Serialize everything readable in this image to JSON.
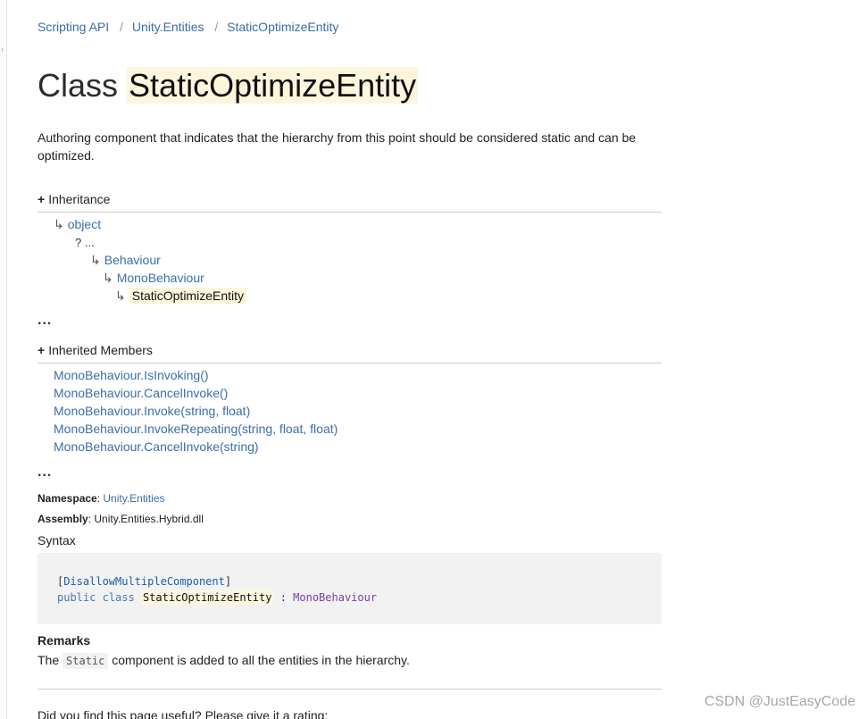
{
  "breadcrumb": {
    "items": [
      "Scripting API",
      "Unity.Entities",
      "StaticOptimizeEntity"
    ],
    "separator": "/"
  },
  "title": {
    "prefix": "Class",
    "name": "StaticOptimizeEntity"
  },
  "summary": "Authoring component that indicates that the hierarchy from this point should be considered static and can be optimized.",
  "inheritance": {
    "toggle": "+",
    "heading": "Inheritance",
    "arrow": "↳",
    "chain": {
      "object": "object",
      "gap": "? ...",
      "behaviour": "Behaviour",
      "monobehaviour": "MonoBehaviour",
      "current": "StaticOptimizeEntity"
    },
    "more": "..."
  },
  "inherited_members": {
    "toggle": "+",
    "heading": "Inherited Members",
    "items": [
      "MonoBehaviour.IsInvoking()",
      "MonoBehaviour.CancelInvoke()",
      "MonoBehaviour.Invoke(string, float)",
      "MonoBehaviour.InvokeRepeating(string, float, float)",
      "MonoBehaviour.CancelInvoke(string)"
    ],
    "more": "..."
  },
  "namespace": {
    "label": "Namespace",
    "value": "Unity.Entities"
  },
  "assembly": {
    "label": "Assembly",
    "value": "Unity.Entities.Hybrid.dll"
  },
  "syntax": {
    "label": "Syntax",
    "attr_open": "[",
    "attribute": "DisallowMultipleComponent",
    "attr_close": "]",
    "kw_public": "public",
    "kw_class": "class",
    "class_name": "StaticOptimizeEntity",
    "colon": ":",
    "base": "MonoBehaviour"
  },
  "remarks": {
    "title": "Remarks",
    "before": "The",
    "code": "Static",
    "after": "component is added to all the entities in the hierarchy."
  },
  "rating_question": "Did you find this page useful? Please give it a rating:",
  "watermark": "CSDN @JustEasyCode",
  "colors": {
    "link": "#3a6fa8",
    "highlight": "#fdf6dd",
    "code_bg": "#f2f2f2"
  }
}
